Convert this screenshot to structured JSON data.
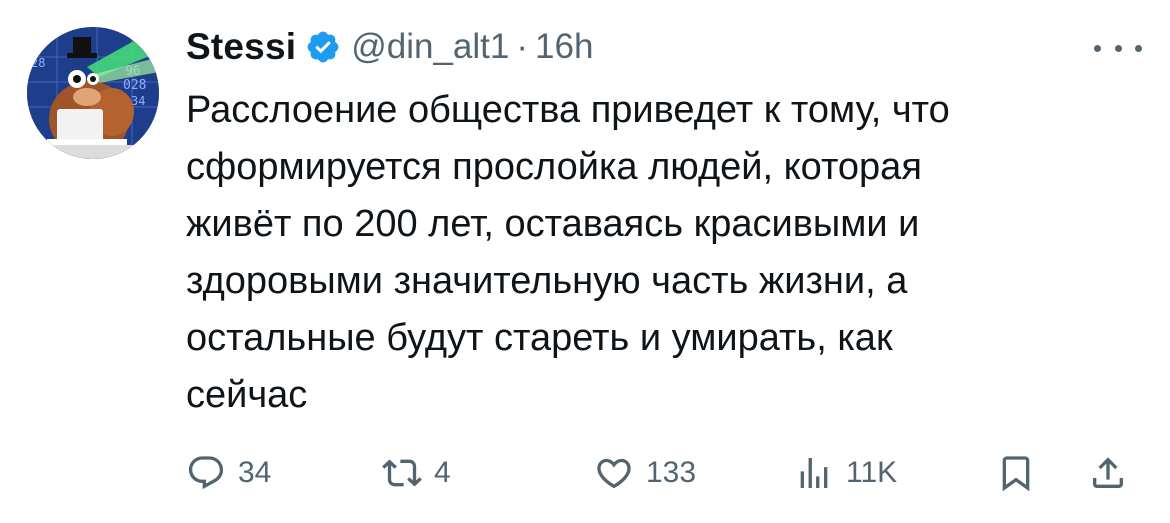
{
  "author": {
    "display_name": "Stessi",
    "handle": "@din_alt1",
    "separator": "·",
    "time": "16h",
    "verified": true
  },
  "tweet": {
    "text": "Расслоение общества приведет к тому, что\nсформируется прослойка людей, которая\nживёт по 200 лет, оставаясь красивыми и\nздоровыми значительную часть жизни, а\nостальные будут стареть и умирать, как\nсейчас"
  },
  "actions": {
    "replies": "34",
    "reposts": "4",
    "likes": "133",
    "views": "11K"
  },
  "icons": {
    "verified": "verified-badge-icon",
    "more": "more-icon",
    "reply": "reply-icon",
    "repost": "repost-icon",
    "like": "heart-icon",
    "views": "views-icon",
    "bookmark": "bookmark-icon",
    "share": "share-icon"
  },
  "colors": {
    "text": "#0f1419",
    "secondary": "#536471",
    "verified": "#1d9bf0"
  }
}
